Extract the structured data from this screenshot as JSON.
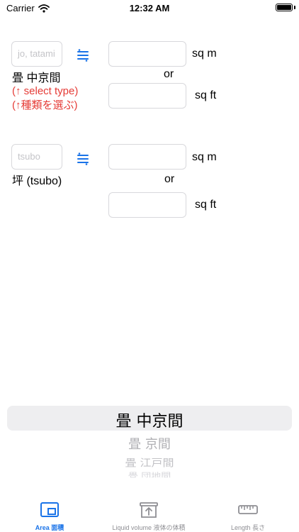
{
  "status_bar": {
    "carrier": "Carrier",
    "time": "12:32 AM",
    "battery_level": 1.0
  },
  "area_jo": {
    "input_placeholder": "jo, tatami",
    "selected_type_label": "畳 中京間",
    "hint_line_1": "(↑ select type)",
    "hint_line_2": "(↑種類を選ぶ)",
    "approx_icon": "approx-equal-icon",
    "sqm_value": "",
    "sqm_unit": "sq m",
    "or_label": "or",
    "sqft_value": "",
    "sqft_unit": "sq ft"
  },
  "area_tsubo": {
    "input_placeholder": "tsubo",
    "label": "坪 (tsubo)",
    "approx_icon": "approx-equal-icon",
    "sqm_value": "",
    "sqm_unit": "sq m",
    "or_label": "or",
    "sqft_value": "",
    "sqft_unit": "sq ft"
  },
  "picker": {
    "selected": "畳 中京間",
    "options_below": [
      "畳 京間",
      "畳 江戸間",
      "畳 団地間"
    ]
  },
  "tab_bar": {
    "tabs": [
      {
        "label": "Area 面積",
        "icon": "area-icon",
        "active": true
      },
      {
        "label": "Liquid volume 液体の体積",
        "icon": "container-icon",
        "active": false
      },
      {
        "label": "Length 長さ",
        "icon": "ruler-icon",
        "active": false
      }
    ]
  },
  "colors": {
    "accent": "#1a73e8",
    "hint_red": "#e53b36",
    "inactive_gray": "#8e8e93",
    "field_border": "#d8d8dc",
    "picker_highlight": "#eeeef0"
  }
}
